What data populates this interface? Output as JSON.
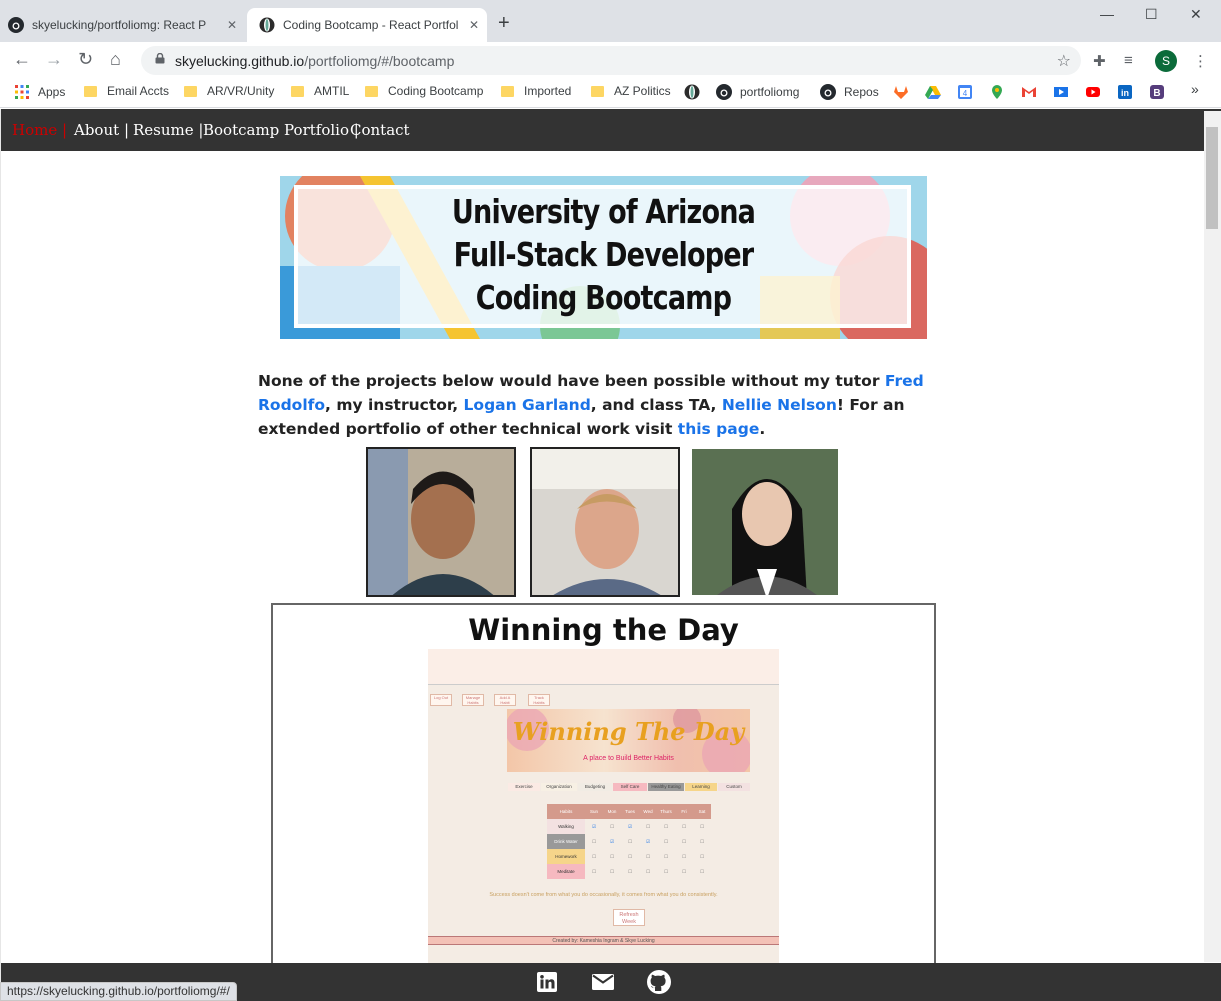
{
  "browser": {
    "tabs": [
      {
        "title": "skyelucking/portfoliomg: React P",
        "active": false
      },
      {
        "title": "Coding Bootcamp - React Portfol",
        "active": true
      }
    ],
    "url_host": "skyelucking.github.io",
    "url_path": "/portfoliomg/#/bootcamp",
    "profile_initial": "S",
    "bookmarks": [
      "Apps",
      "Email Accts",
      "AR/VR/Unity",
      "AMTIL",
      "Coding Bootcamp",
      "Imported",
      "AZ Politics",
      "portfoliomg",
      "Repos"
    ],
    "more_bookmarks": "»",
    "status_url": "https://skyelucking.github.io/portfoliomg/#/"
  },
  "nav": {
    "home": "Home",
    "about": "About",
    "resume": "Resume",
    "portfolio": "Bootcamp Portfolio",
    "contact": "Contact",
    "sep": "|"
  },
  "banner": {
    "line1": "University of Arizona",
    "line2": "Full-Stack Developer",
    "line3": "Coding Bootcamp"
  },
  "intro": {
    "t1": "None of the projects below would have been possible without my tutor ",
    "tutor": "Fred Rodolfo",
    "t2": ", my instructor, ",
    "instructor": "Logan Garland",
    "t3": ", and class TA, ",
    "ta": "Nellie Nelson",
    "t4": "! For an extended portfolio of other technical work visit ",
    "link": "this page",
    "t5": "."
  },
  "project": {
    "title": "Winning the Day",
    "screenshot": {
      "buttons": [
        "Log Out",
        "Manage Habits",
        "Add A Habit",
        "Track Habits"
      ],
      "logo": "Winning The Day",
      "tagline": "A place to Build Better Habits",
      "categories": [
        "Exercise",
        "Organization",
        "Budgeting",
        "Self Care",
        "Healthy Eating",
        "Learning",
        "Custom"
      ],
      "days": [
        "Habits",
        "Sun",
        "Mon",
        "Tues",
        "Wed",
        "Thurs",
        "Fri",
        "Sat"
      ],
      "habits": [
        "Walking",
        "Drink Water",
        "Homework",
        "Meditate"
      ],
      "quote": "Success doesn't come from what you do occasionally, it comes from what you do consistently.",
      "refresh": "Refresh Week",
      "credits": "Created by: Kameshia Ingram & Skye Lucking"
    }
  },
  "colors": {
    "navbar": "#333333",
    "link": "#1a73e8",
    "home_active": "#cc0000"
  }
}
